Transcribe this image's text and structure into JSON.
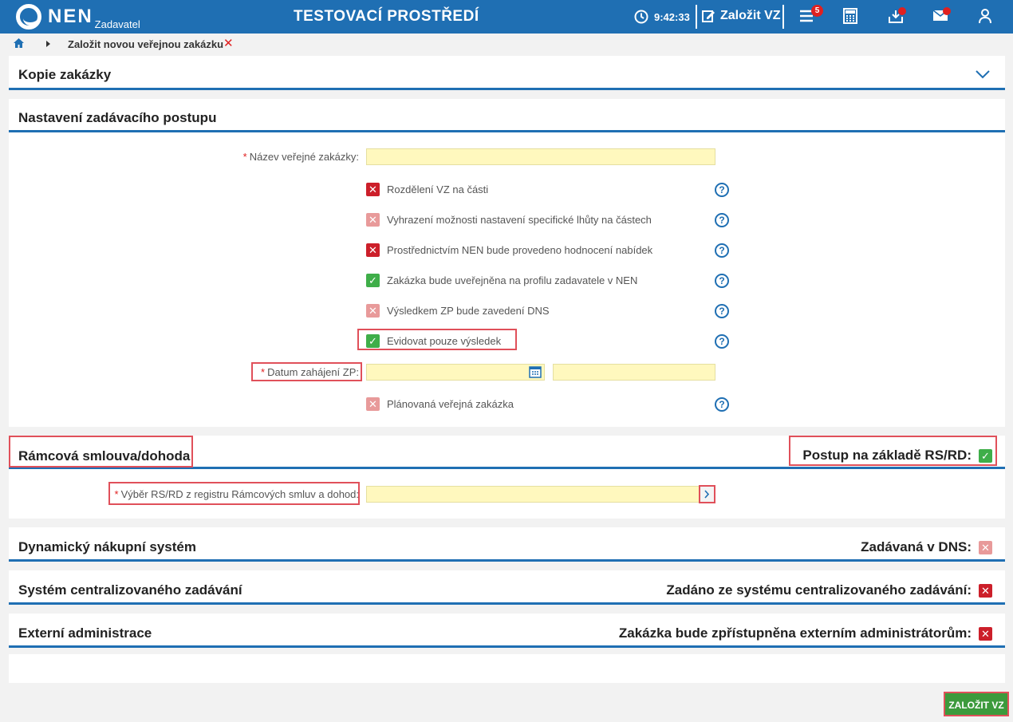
{
  "header": {
    "logo_text": "NEN",
    "logo_sub": "Zadavatel",
    "env_title": "TESTOVACÍ PROSTŘEDÍ",
    "time": "9:42:33",
    "create_label": "Založit VZ",
    "menu_badge": "5"
  },
  "breadcrumb": {
    "current": "Založit novou veřejnou zakázku"
  },
  "sections": {
    "copy": {
      "title": "Kopie zakázky"
    },
    "settings": {
      "title": "Nastavení zadávacího postupu",
      "name_label": "Název veřejné zakázky:",
      "options": [
        {
          "label": "Rozdělení VZ na části",
          "state": "unchecked"
        },
        {
          "label": "Vyhrazení možnosti nastavení specifické lhůty na částech",
          "state": "disabled"
        },
        {
          "label": "Prostřednictvím NEN bude provedeno hodnocení nabídek",
          "state": "unchecked"
        },
        {
          "label": "Zakázka bude uveřejněna na profilu zadavatele v NEN",
          "state": "checked"
        },
        {
          "label": "Výsledkem ZP bude zavedení DNS",
          "state": "disabled"
        },
        {
          "label": "Evidovat pouze výsledek",
          "state": "checked"
        }
      ],
      "date_label": "Datum zahájení ZP:",
      "planned_label": "Plánovaná veřejná zakázka"
    },
    "framework": {
      "title": "Rámcová smlouva/dohoda",
      "right_label": "Postup na základě RS/RD:",
      "select_label": "Výběr RS/RD z registru Rámcových smluv a dohod:"
    },
    "dns": {
      "title": "Dynamický nákupní systém",
      "right_label": "Zadávaná v DNS:"
    },
    "central": {
      "title": "Systém centralizovaného zadávání",
      "right_label": "Zadáno ze systému centralizovaného zadávání:"
    },
    "external": {
      "title": "Externí administrace",
      "right_label": "Zakázka bude zpřístupněna externím administrátorům:"
    }
  },
  "footer": {
    "submit_label": "ZALOŽIT VZ"
  },
  "colors": {
    "brand": "#1f6fb3",
    "input_bg": "#fff8be",
    "highlight": "#e0505a",
    "ok": "#3fae49",
    "error": "#cc1f2a"
  }
}
